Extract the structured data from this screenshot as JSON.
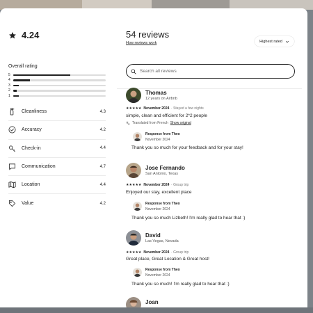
{
  "summary": {
    "rating": "4.24",
    "overall_label": "Overall rating",
    "distribution": [
      {
        "stars": "5",
        "fraction": 0.62
      },
      {
        "stars": "4",
        "fraction": 0.18
      },
      {
        "stars": "3",
        "fraction": 0.06
      },
      {
        "stars": "2",
        "fraction": 0.04
      },
      {
        "stars": "1",
        "fraction": 0.06
      }
    ],
    "categories": [
      {
        "label": "Cleanliness",
        "score": "4.3",
        "icon": "spray-bottle-icon"
      },
      {
        "label": "Accuracy",
        "score": "4.2",
        "icon": "check-circle-icon"
      },
      {
        "label": "Check-in",
        "score": "4.4",
        "icon": "key-icon"
      },
      {
        "label": "Communication",
        "score": "4.7",
        "icon": "chat-bubble-icon"
      },
      {
        "label": "Location",
        "score": "4.4",
        "icon": "map-icon"
      },
      {
        "label": "Value",
        "score": "4.2",
        "icon": "tag-icon"
      }
    ]
  },
  "header": {
    "title": "54 reviews",
    "how_link": "How reviews work",
    "sort_label": "Highest rated"
  },
  "search": {
    "placeholder": "Search all reviews"
  },
  "reviews": [
    {
      "name": "Thomas",
      "subtitle": "12 years on Airbnb",
      "stars": "★★★★★",
      "date": "November 2024",
      "stay": "Stayed a few nights",
      "text": "simple, clean and efficient for 2*2 people",
      "translated": "Translated from French",
      "show_original": "Show original",
      "response": {
        "from": "Response from Theo",
        "date": "November 2024",
        "text": "Thank you so much for your feedback and for your stay!"
      }
    },
    {
      "name": "Jose Fernando",
      "subtitle": "San Antonio, Texas",
      "stars": "★★★★★",
      "date": "November 2024",
      "stay": "Group trip",
      "text": "Enjoyed our stay, excellent place",
      "response": {
        "from": "Response from Theo",
        "date": "November 2024",
        "text": "Thank you so much Lizbeth! I'm really glad to hear that :)"
      }
    },
    {
      "name": "David",
      "subtitle": "Las Vegas, Nevada",
      "stars": "★★★★★",
      "date": "November 2024",
      "stay": "Group trip",
      "text": "Great place, Great Location & Great host!",
      "response": {
        "from": "Response from Theo",
        "date": "November 2024",
        "text": "Thank you so much! I'm really glad to hear that :)"
      }
    },
    {
      "name": "Joan",
      "subtitle": ""
    }
  ]
}
